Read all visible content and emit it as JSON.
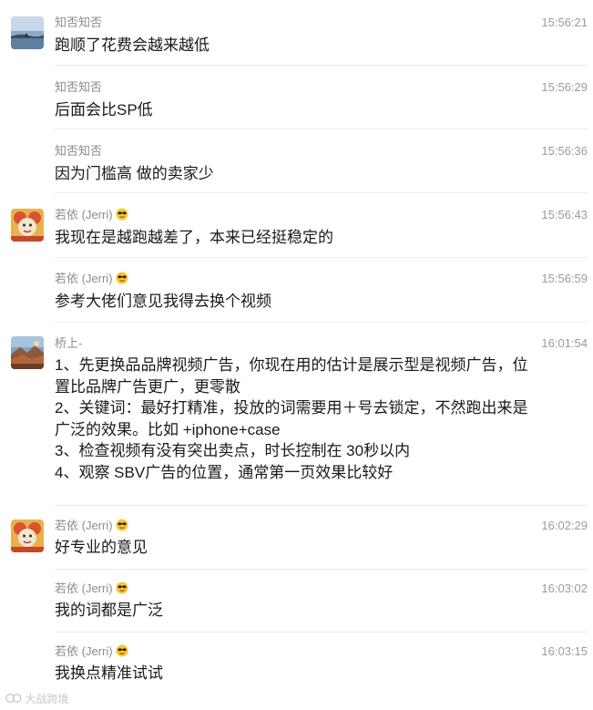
{
  "messages": [
    {
      "sender": "知否知否",
      "emoji": false,
      "time": "15:56:21",
      "lines": [
        "跑顺了花费会越来越低"
      ]
    },
    {
      "sender": "知否知否",
      "emoji": false,
      "time": "15:56:29",
      "lines": [
        "后面会比SP低"
      ]
    },
    {
      "sender": "知否知否",
      "emoji": false,
      "time": "15:56:36",
      "lines": [
        "因为门槛高 做的卖家少"
      ]
    },
    {
      "sender": "若依 (Jerri)",
      "emoji": true,
      "time": "15:56:43",
      "lines": [
        "我现在是越跑越差了，本来已经挺稳定的"
      ]
    },
    {
      "sender": "若依 (Jerri)",
      "emoji": true,
      "time": "15:56:59",
      "lines": [
        "参考大佬们意见我得去换个视频"
      ]
    },
    {
      "sender": "桥上-",
      "emoji": false,
      "time": "16:01:54",
      "lines": [
        "1、先更换品品牌视频广告，你现在用的估计是展示型是视频广告，位",
        "置比品牌广告更广，更零散",
        "2、关键词：最好打精准，投放的词需要用＋号去锁定，不然跑出来是",
        "广泛的效果。比如 +iphone+case",
        "3、检查视频有没有突出卖点，时长控制在 30秒以内",
        "4、观察 SBV广告的位置，通常第一页效果比较好"
      ]
    },
    {
      "sender": "若依 (Jerri)",
      "emoji": true,
      "time": "16:02:29",
      "lines": [
        "好专业的意见"
      ]
    },
    {
      "sender": "若依 (Jerri)",
      "emoji": true,
      "time": "16:03:02",
      "lines": [
        "我的词都是广泛"
      ]
    },
    {
      "sender": "若依 (Jerri)",
      "emoji": true,
      "time": "16:03:15",
      "lines": [
        "我换点精准试试"
      ]
    }
  ],
  "watermark": "大战跨境",
  "avatars": {
    "zhifou": "lake-landscape-avatar",
    "ruoyi": "cartoon-character-avatar",
    "qiaoshang": "mountain-sunset-avatar"
  },
  "colors": {
    "sender": "#8c8c8c",
    "time": "#9b9b9b",
    "text": "#1a1a1a",
    "divider": "#ececec"
  }
}
